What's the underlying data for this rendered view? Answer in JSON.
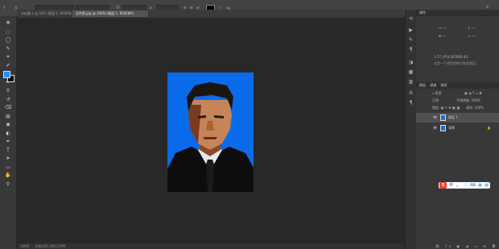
{
  "options_bar": {
    "font_family": "Adobe 黑体 Std",
    "font_size": "14 点",
    "leading": "0.05",
    "antialias": "锐利"
  },
  "tabs": [
    {
      "label": "未标题-1 @ 50% (图层 1, RGB/8)"
    },
    {
      "label": "证件照.jpg @ 100% (图层 1, RGB/8#)"
    }
  ],
  "toolbar": {
    "tools": [
      "move-tool",
      "marquee-tool",
      "lasso-tool",
      "quick-select-tool",
      "crop-tool",
      "eyedropper-tool",
      "healing-tool",
      "brush-tool",
      "stamp-tool",
      "history-brush-tool",
      "eraser-tool",
      "gradient-tool",
      "blur-tool",
      "dodge-tool",
      "pen-tool",
      "type-tool",
      "path-select-tool",
      "shape-tool",
      "hand-tool",
      "zoom-tool"
    ],
    "glyphs": [
      "✥",
      "⬚",
      "◯",
      "✎",
      "⌗",
      "✐",
      "✚",
      "✏",
      "⚲",
      "↺",
      "⌫",
      "▤",
      "◉",
      "◐",
      "✒",
      "T",
      "➤",
      "▭",
      "✋",
      "⚲"
    ],
    "foreground_color": "#1e90ff",
    "background_color": "#000000"
  },
  "canvas": {
    "photo_bg": "#0a6bea",
    "suit": "#0d0d0d",
    "shirt": "#e8e8e8",
    "tie": "#1a1a1a",
    "skin": "#c68558",
    "hair": "#1b1510"
  },
  "status_bar": {
    "zoom": "100%",
    "doc": "文档:601.2K/1.17M"
  },
  "properties_panel": {
    "title": "属性",
    "info_line": "1.77,,974,267806.43",
    "hint": "这是一个使用智能对象的图层。"
  },
  "layers_panel": {
    "tabs": [
      "图层",
      "通道",
      "路径"
    ],
    "kind_label": "类型",
    "blend_mode": "正常",
    "opacity_label": "不透明度:",
    "opacity": "100%",
    "lock_label": "锁定:",
    "fill_label": "填充:",
    "fill": "100%",
    "layers": [
      {
        "name": "图层 1",
        "selected": true
      },
      {
        "name": "背景",
        "selected": false
      }
    ]
  },
  "ime_bar": {
    "logo": "S",
    "items": [
      "中",
      "。",
      "♪",
      "⌨",
      "▣",
      "▦"
    ]
  }
}
